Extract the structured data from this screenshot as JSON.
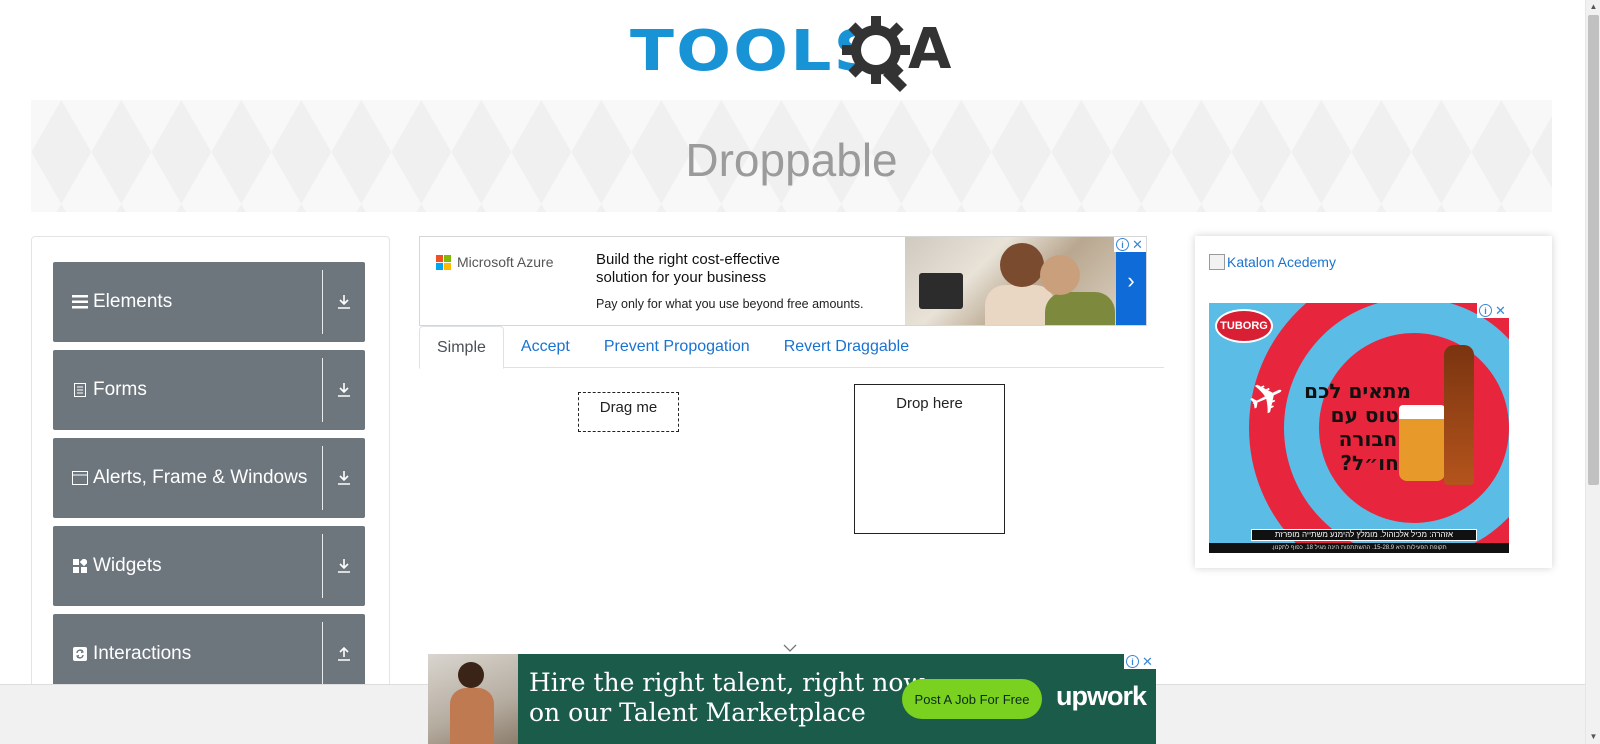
{
  "header": {
    "logo_text": "TOOLS",
    "logo_suffix": "A",
    "logo_icon": "gear-magnifier-icon"
  },
  "banner": {
    "title": "Droppable"
  },
  "sidebar": {
    "groups": [
      {
        "label": "Elements",
        "icon": "hamburger-icon",
        "toggle": "download-icon"
      },
      {
        "label": "Forms",
        "icon": "document-icon",
        "toggle": "download-icon"
      },
      {
        "label": "Alerts, Frame & Windows",
        "icon": "window-icon",
        "toggle": "download-icon"
      },
      {
        "label": "Widgets",
        "icon": "widgets-icon",
        "toggle": "download-icon"
      },
      {
        "label": "Interactions",
        "icon": "refresh-icon",
        "toggle": "upload-icon"
      }
    ]
  },
  "ad_top": {
    "brand": "Microsoft Azure",
    "headline": "Build the right cost-effective solution for your business",
    "subline": "Pay only for what you use beyond free amounts.",
    "next": "›",
    "colors": {
      "arrow_bg": "#0f6bd8"
    }
  },
  "tabs": [
    {
      "label": "Simple",
      "active": true
    },
    {
      "label": "Accept",
      "active": false
    },
    {
      "label": "Prevent Propogation",
      "active": false
    },
    {
      "label": "Revert Draggable",
      "active": false
    }
  ],
  "simple": {
    "draggable": "Drag me",
    "droppable": "Drop here"
  },
  "ad_right": {
    "link_text": "Katalon Acedemy",
    "tuborg_badge": "TUBORG",
    "tuborg_heading": "מתאים לכם לטוס עם החבורה לחו״ל?",
    "tuborg_warning": "אזהרה: מכיל אלכוהול. מומלץ להימנע משתייה מופרזת",
    "tuborg_fine": "תקופת הפעילות היא 15-28.9. ההשתתפות הינה מגיל 18. כפוף לתקנון."
  },
  "ad_bottom": {
    "headline_line1": "Hire the right talent, right now",
    "headline_line2": "on our Talent Marketplace",
    "cta": "Post A Job For Free",
    "brand": "upwork",
    "colors": {
      "bg": "#1a5b4a",
      "cta_bg": "#7ad11f"
    }
  },
  "colors": {
    "brand_blue": "#1893d5",
    "sidebar_group": "#6d757d",
    "link": "#1a73d1"
  }
}
